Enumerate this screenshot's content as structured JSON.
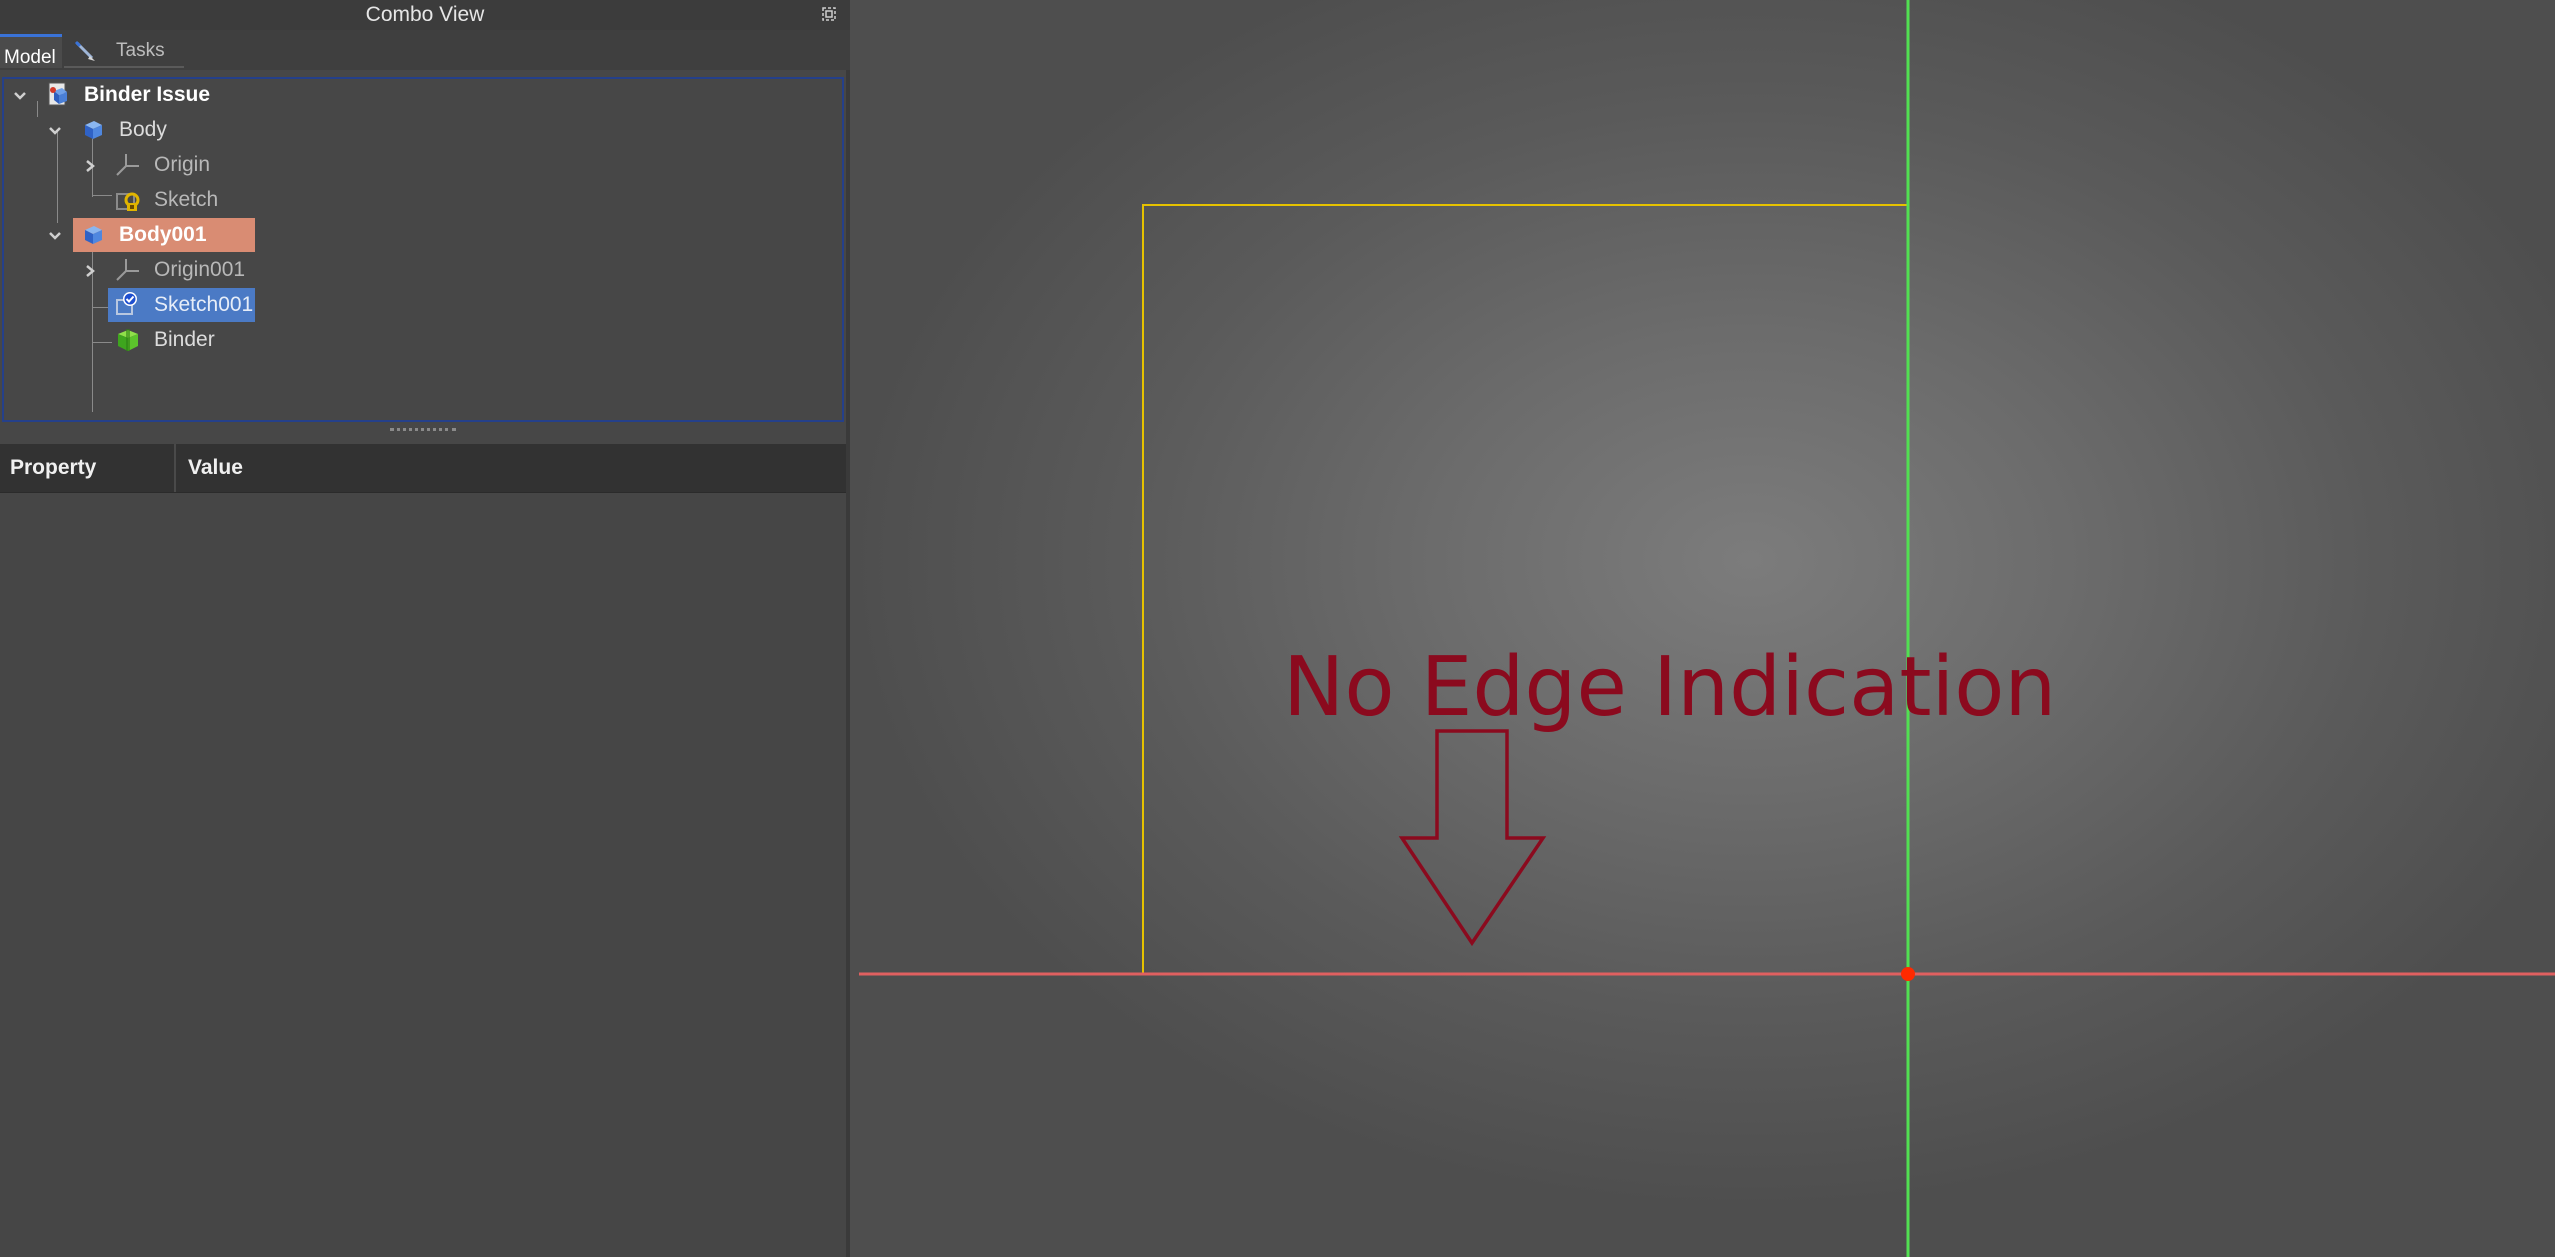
{
  "combo_view": {
    "title": "Combo View",
    "tabs": [
      {
        "label": "Model",
        "active": true
      },
      {
        "label": "Tasks",
        "active": false
      }
    ]
  },
  "tree": {
    "items": [
      {
        "label": "Binder Issue",
        "icon": "document-icon",
        "bold": true
      },
      {
        "label": "Body",
        "icon": "body-icon"
      },
      {
        "label": "Origin",
        "icon": "origin-axes-icon"
      },
      {
        "label": "Sketch",
        "icon": "sketch-icon"
      },
      {
        "label": "Body001",
        "icon": "body-icon",
        "bold": true,
        "active_body": true
      },
      {
        "label": "Origin001",
        "icon": "origin-axes-icon"
      },
      {
        "label": "Sketch001",
        "icon": "sketch-edit-icon",
        "selected": true
      },
      {
        "label": "Binder",
        "icon": "shape-binder-icon"
      }
    ]
  },
  "property_editor": {
    "columns": [
      "Property",
      "Value"
    ]
  },
  "viewport": {
    "annotation": "No Edge Indication",
    "colors": {
      "annotation": "#8b0a1e",
      "x_axis": "#e06060",
      "y_axis": "#52e052",
      "sketch_edges": "#e6c200",
      "origin_point": "#ff2a00"
    }
  },
  "colors": {
    "active_body_highlight": "#d98c73",
    "selection_highlight": "#4b7ac5",
    "panel_bg": "#474747"
  }
}
